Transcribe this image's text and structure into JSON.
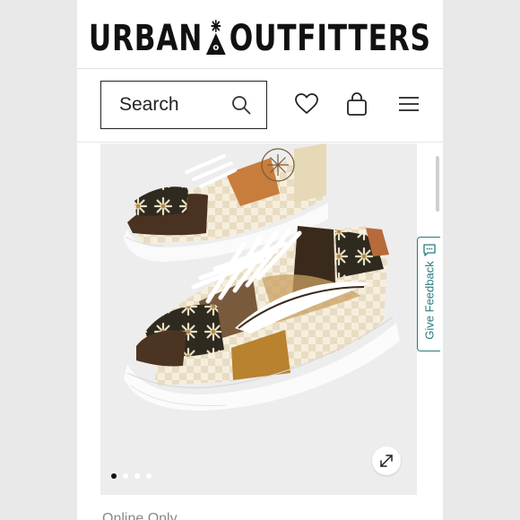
{
  "brand": {
    "left": "URBAN",
    "right": "OUTFITTERS",
    "logo_icon": "tent-star-logo"
  },
  "search": {
    "label": "Search",
    "icon": "search-icon"
  },
  "header_icons": {
    "wishlist": "heart-icon",
    "cart": "bag-icon",
    "menu": "hamburger-menu-icon"
  },
  "product": {
    "image_icon": "sneaker-product-image",
    "expand_icon": "expand-arrows-icon"
  },
  "carousel": {
    "slides": 4,
    "active_index": 0
  },
  "feedback": {
    "label": "Give Feedback",
    "icon": "chat-feedback-icon",
    "accent": "#2a7a7d"
  },
  "bottom": {
    "partial_text": "Online Only"
  }
}
